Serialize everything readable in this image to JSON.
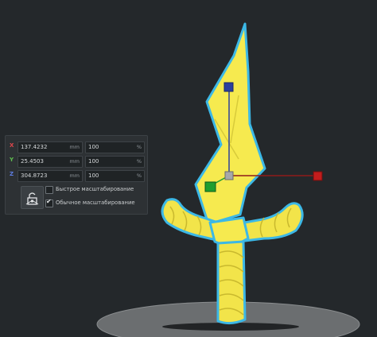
{
  "scale_panel": {
    "rows": [
      {
        "axis": "X",
        "value": "137.4232",
        "unit": "mm",
        "percent": "100",
        "percent_unit": "%"
      },
      {
        "axis": "Y",
        "value": "25.4503",
        "unit": "mm",
        "percent": "100",
        "percent_unit": "%"
      },
      {
        "axis": "Z",
        "value": "304.8723",
        "unit": "mm",
        "percent": "100",
        "percent_unit": "%"
      }
    ],
    "snap_scaling": {
      "label": "Быстрое масштабирование",
      "checked": false
    },
    "uniform_scaling": {
      "label": "Обычное масштабирование",
      "checked": true
    },
    "lock_icon": "scale-lock-icon"
  },
  "colors": {
    "background": "#24282b",
    "model_fill": "#f6ea4f",
    "model_outline": "#3cb8e6",
    "axis_x": "#c21d1d",
    "axis_y": "#1f9e2f",
    "axis_z": "#2c3f9e",
    "axis_x_label": "#e0474c",
    "axis_y_label": "#5fbf4f",
    "axis_z_label": "#5f7fe6"
  }
}
